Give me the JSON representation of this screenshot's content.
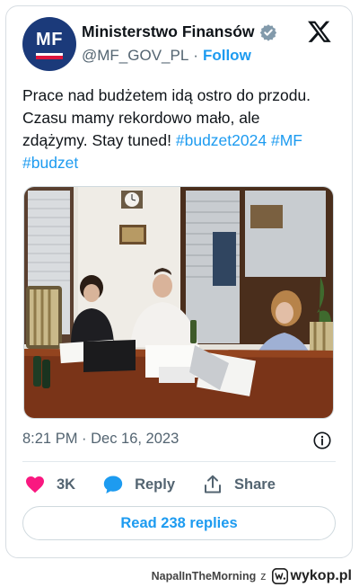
{
  "tweet": {
    "author": {
      "avatar_text": "MF",
      "display_name": "Ministerstwo Finansów",
      "handle": "@MF_GOV_PL",
      "separator": "·",
      "follow_label": "Follow"
    },
    "text_parts": {
      "line1": "Prace nad budżetem idą ostro do przodu.",
      "line2": "Czasu mamy rekordowo mało, ale",
      "line3_text": "zdążymy. Stay tuned! ",
      "hashtag1": "#budzet2024",
      "hashtag2": "#MF",
      "hashtag3": "#budzet"
    },
    "timestamp": "8:21 PM · Dec 16, 2023",
    "actions": {
      "likes_count": "3K",
      "reply_label": "Reply",
      "share_label": "Share"
    },
    "read_replies_label": "Read 238 replies"
  },
  "footer": {
    "username": "NapalInTheMorning",
    "z_label": "z",
    "site": "wykop.pl"
  },
  "colors": {
    "accent": "#1d9bf0",
    "like": "#f91880",
    "secondary_text": "#536471",
    "avatar_bg": "#1b3a7a"
  },
  "icons": [
    "verified-badge-icon",
    "x-logo-icon",
    "info-icon",
    "heart-icon",
    "reply-bubble-icon",
    "share-icon",
    "wykop-logo-icon"
  ]
}
